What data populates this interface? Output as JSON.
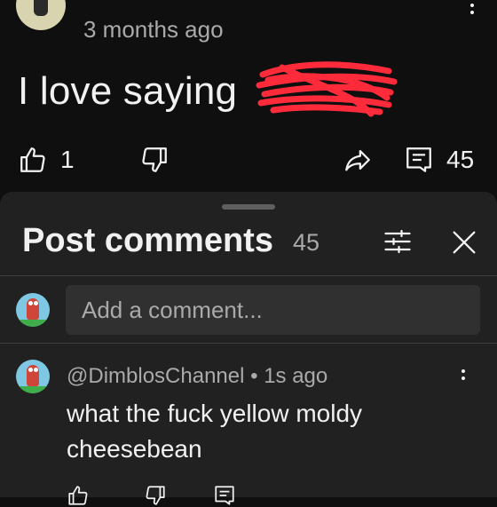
{
  "post": {
    "timestamp": "3 months ago",
    "text": "I love saying",
    "like_count": "1",
    "comment_count": "45"
  },
  "comments_panel": {
    "title": "Post comments",
    "count": "45",
    "input_placeholder": "Add a comment..."
  },
  "comments": [
    {
      "handle": "@DimblosChannel",
      "time": "1s ago",
      "handle_line": "@DimblosChannel • 1s ago",
      "text": "what the fuck yellow moldy cheesebean"
    }
  ],
  "colors": {
    "background": "#0f0f0f",
    "sheet": "#212121",
    "secondary_text": "#aaaaaa",
    "redaction": "#ff2b3a"
  },
  "icons": [
    "thumbs-up-icon",
    "thumbs-down-icon",
    "share-icon",
    "comment-icon",
    "filter-icon",
    "close-icon",
    "more-vert-icon"
  ]
}
